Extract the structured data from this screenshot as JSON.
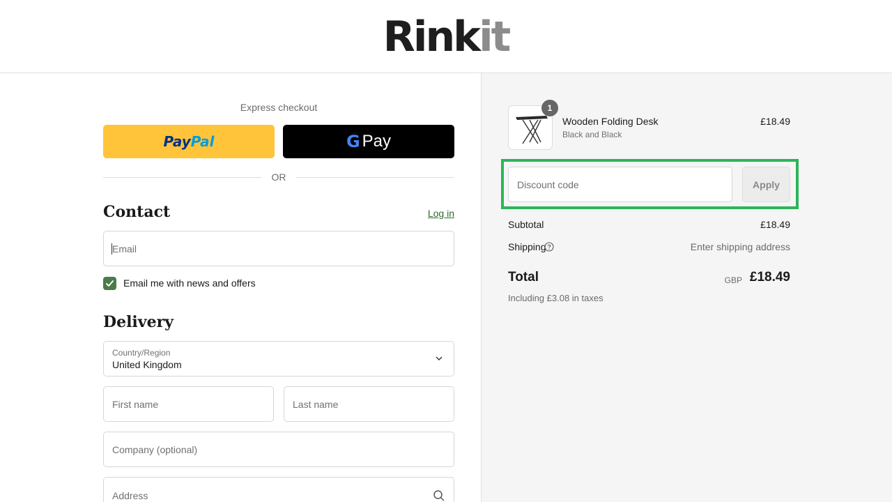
{
  "brand": {
    "logo_main": "Rink",
    "logo_accent": "it"
  },
  "express": {
    "label": "Express checkout",
    "paypal_part1": "Pay",
    "paypal_part2": "Pal",
    "gpay_g": "G",
    "gpay_label": "Pay",
    "or_text": "OR"
  },
  "contact": {
    "title": "Contact",
    "login_label": "Log in",
    "email_placeholder": "Email",
    "newsletter_label": "Email me with news and offers",
    "newsletter_checked": true
  },
  "delivery": {
    "title": "Delivery",
    "country_label": "Country/Region",
    "country_value": "United Kingdom",
    "first_name_placeholder": "First name",
    "last_name_placeholder": "Last name",
    "company_placeholder": "Company (optional)",
    "address_placeholder": "Address"
  },
  "summary": {
    "item": {
      "quantity": "1",
      "name": "Wooden Folding Desk",
      "variant": "Black and Black",
      "price": "£18.49"
    },
    "discount_placeholder": "Discount code",
    "apply_label": "Apply",
    "subtotal_label": "Subtotal",
    "subtotal_value": "£18.49",
    "shipping_label": "Shipping",
    "shipping_value": "Enter shipping address",
    "total_label": "Total",
    "currency": "GBP",
    "total_value": "£18.49",
    "taxes_note": "Including £3.08 in taxes"
  },
  "colors": {
    "paypal_bg": "#ffc439",
    "gpay_bg": "#000000",
    "checkbox_green": "#4b7c4b",
    "link_green": "#2d6a2d",
    "highlight_outline": "#2bb55a",
    "summary_bg": "#f5f5f5"
  }
}
